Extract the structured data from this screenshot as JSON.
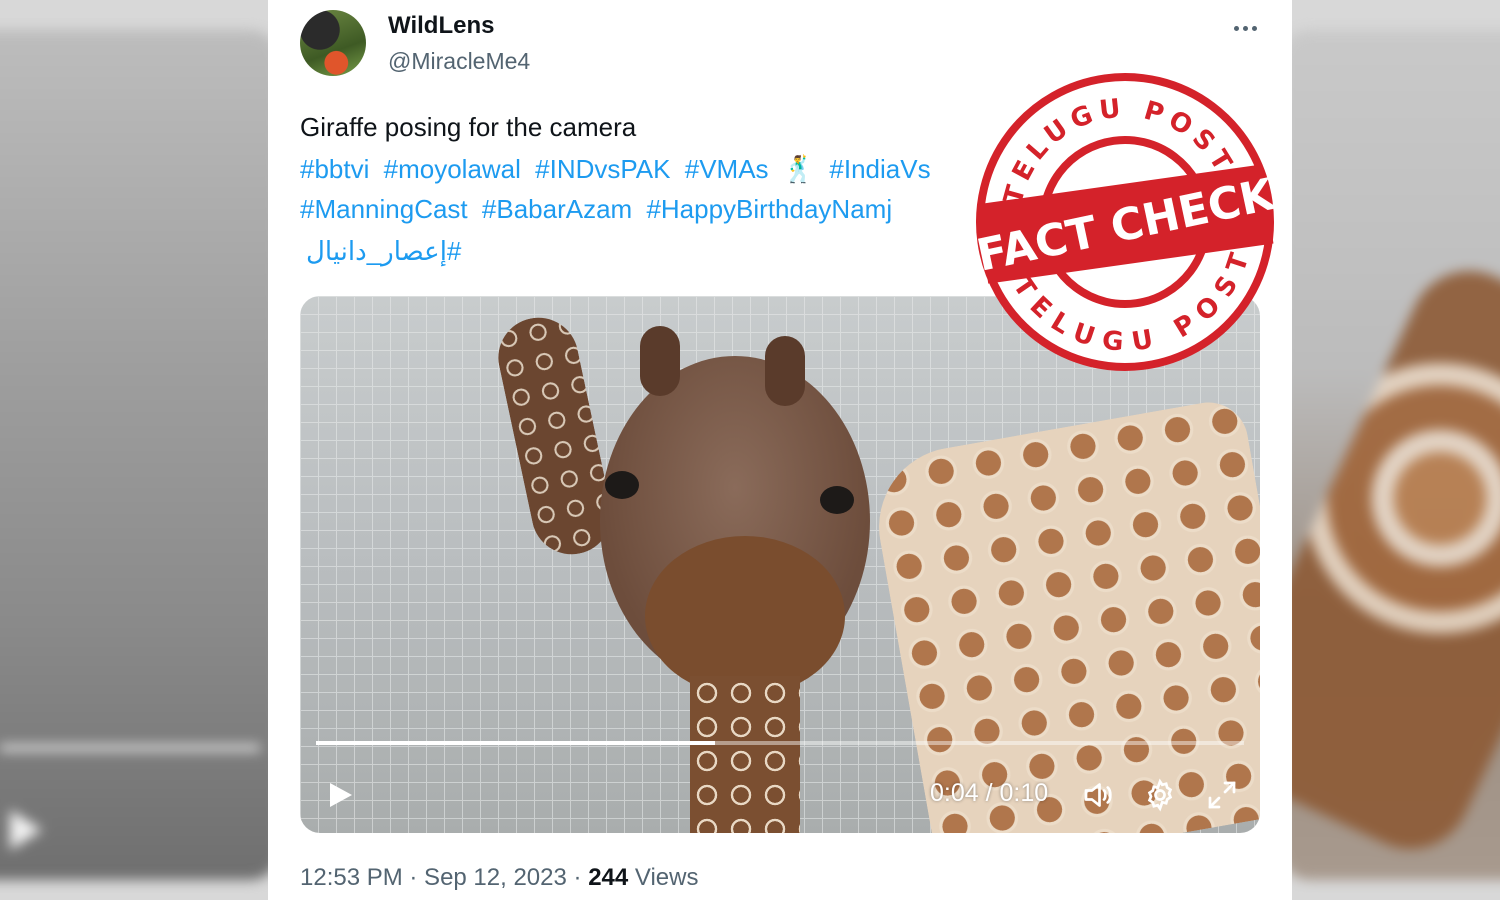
{
  "tweet": {
    "display_name": "WildLens",
    "handle": "@MiracleMe4",
    "text": "Giraffe posing for the camera",
    "hashtags_row1": [
      "#bbtvi",
      "#moyolawal",
      "#INDvsPAK",
      "#VMAs",
      "🕺",
      "#IndiaVs"
    ],
    "hashtags_row2": [
      "#ManningCast",
      "#BabarAzam",
      "#HappyBirthdayNamj"
    ],
    "hashtags_row3": [
      "#إعصار_دانيال"
    ],
    "timestamp": "12:53 PM · Sep 12, 2023 · ",
    "views_count": "244",
    "views_label": " Views"
  },
  "video": {
    "time_display": "0:04 / 0:10",
    "progress_fraction": 0.43,
    "icons": [
      "play-icon",
      "volume-icon",
      "settings-gear-icon",
      "fullscreen-icon"
    ]
  },
  "stamp": {
    "top_text": "TELUGU POST",
    "main_text": "FACT CHECK",
    "bottom_text": "TELUGU POST",
    "color": "#d4222a"
  }
}
